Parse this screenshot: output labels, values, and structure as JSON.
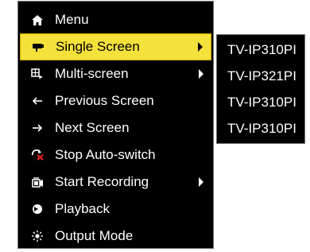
{
  "menu": {
    "items": [
      {
        "label": "Menu",
        "icon": "home-icon",
        "has_submenu": false,
        "selected": false
      },
      {
        "label": "Single Screen",
        "icon": "camera-icon",
        "has_submenu": true,
        "selected": true
      },
      {
        "label": "Multi-screen",
        "icon": "multi-screen-icon",
        "has_submenu": true,
        "selected": false
      },
      {
        "label": "Previous Screen",
        "icon": "arrow-left-icon",
        "has_submenu": false,
        "selected": false
      },
      {
        "label": "Next Screen",
        "icon": "arrow-right-icon",
        "has_submenu": false,
        "selected": false
      },
      {
        "label": "Stop Auto-switch",
        "icon": "stop-auto-switch-icon",
        "has_submenu": false,
        "selected": false
      },
      {
        "label": "Start Recording",
        "icon": "recording-icon",
        "has_submenu": true,
        "selected": false
      },
      {
        "label": "Playback",
        "icon": "playback-icon",
        "has_submenu": false,
        "selected": false
      },
      {
        "label": "Output Mode",
        "icon": "output-mode-icon",
        "has_submenu": false,
        "selected": false
      }
    ]
  },
  "submenu": {
    "items": [
      "TV-IP310PI",
      "TV-IP321PI",
      "TV-IP310PI",
      "TV-IP310PI"
    ]
  },
  "colors": {
    "background": "#000000",
    "highlight": "#f4e13a",
    "text": "#ffffff",
    "stop_icon_accent": "#e0201b"
  }
}
